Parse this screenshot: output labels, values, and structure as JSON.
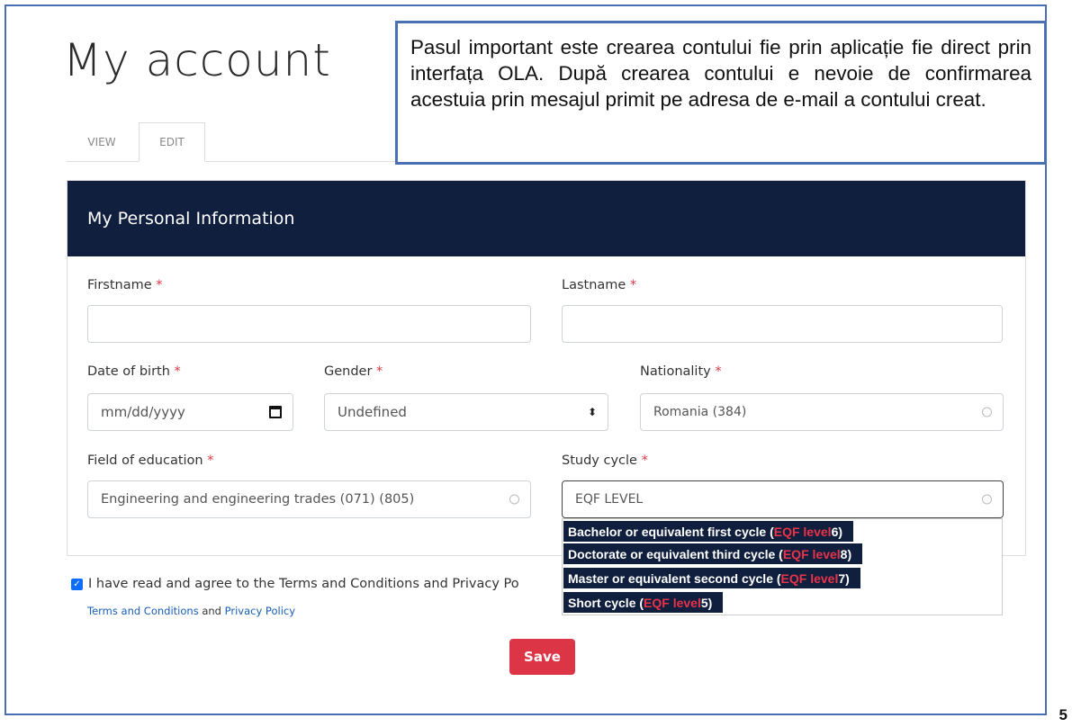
{
  "page": {
    "title": "My account"
  },
  "callout": {
    "text": "Pasul important este crearea contului fie prin aplicație fie direct prin interfața OLA. După crearea contului e nevoie de confirmarea acestuia prin mesajul primit pe adresa de e-mail a contului creat."
  },
  "tabs": [
    {
      "label": "VIEW",
      "active": false
    },
    {
      "label": "EDIT",
      "active": true
    }
  ],
  "card": {
    "header": "My Personal Information",
    "fields": {
      "firstname": {
        "label": "Firstname",
        "value": ""
      },
      "lastname": {
        "label": "Lastname",
        "value": ""
      },
      "date_of_birth": {
        "label": "Date of birth",
        "placeholder": "mm/dd/yyyy"
      },
      "gender": {
        "label": "Gender",
        "value": "Undefined"
      },
      "nationality": {
        "label": "Nationality",
        "value": "Romania (384)"
      },
      "field_of_education": {
        "label": "Field of education",
        "value": "Engineering and engineering trades (071) (805)"
      },
      "study_cycle": {
        "label": "Study cycle",
        "value": "EQF LEVEL"
      }
    },
    "required_mark": "*"
  },
  "study_cycle_options": [
    {
      "prefix": "Bachelor or equivalent first cycle (",
      "highlight": "EQF level",
      "suffix": " 6)"
    },
    {
      "prefix": "Doctorate or equivalent third cycle (",
      "highlight": "EQF level",
      "suffix": " 8)"
    },
    {
      "prefix": "Master or equivalent second cycle (",
      "highlight": "EQF level",
      "suffix": " 7)"
    },
    {
      "prefix": "Short cycle (",
      "highlight": "EQF level",
      "suffix": " 5)"
    }
  ],
  "terms": {
    "checkbox_label": "I have read and agree to the Terms and Conditions and Privacy Po",
    "checked": true,
    "link_terms": "Terms and Conditions",
    "and_text": " and ",
    "link_privacy": "Privacy Policy"
  },
  "save_label": "Save",
  "slide_number": "5",
  "colors": {
    "header_bg": "#0f1f3d",
    "accent_red": "#dc3545",
    "frame_blue": "#4a6fb3"
  }
}
